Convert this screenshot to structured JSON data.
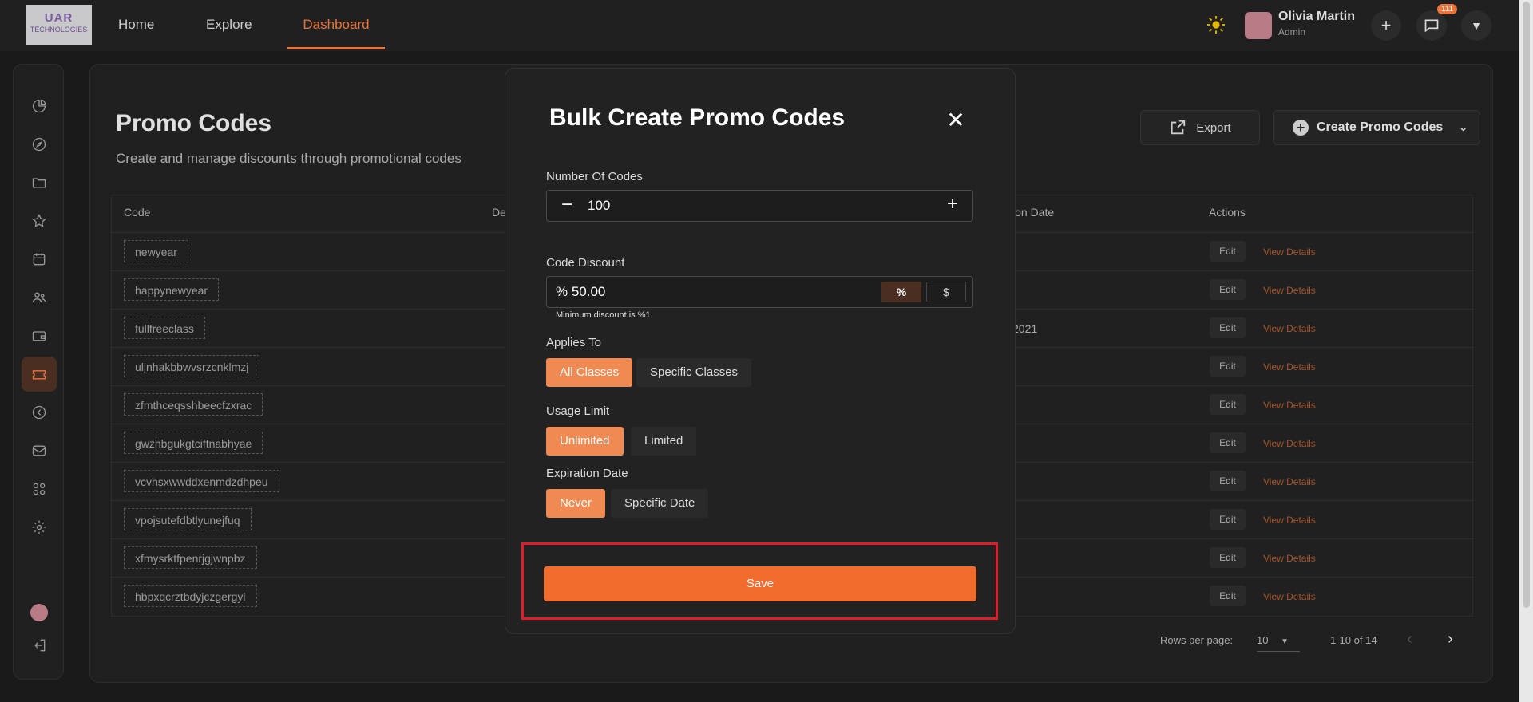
{
  "header": {
    "logo_line1": "UAR",
    "logo_line2": "TECHNOLOGIES",
    "nav": [
      {
        "label": "Home"
      },
      {
        "label": "Explore"
      },
      {
        "label": "Dashboard"
      }
    ],
    "user_name": "Olivia Martin",
    "user_role": "Admin",
    "notification_count": "111"
  },
  "page": {
    "title": "Promo Codes",
    "subtitle": "Create and manage discounts through promotional codes",
    "export_label": "Export",
    "create_label": "Create Promo Codes"
  },
  "table": {
    "headers": [
      "Code",
      "De",
      "ion Date",
      "Actions"
    ],
    "rows": [
      {
        "code": "newyear",
        "date": ""
      },
      {
        "code": "happynewyear",
        "date": ""
      },
      {
        "code": "fullfreeclass",
        "date": "2021"
      },
      {
        "code": "uljnhakbbwvsrzcnklmzj",
        "date": ""
      },
      {
        "code": "zfmthceqsshbeecfzxrac",
        "date": ""
      },
      {
        "code": "gwzhbgukgtciftnabhyae",
        "date": ""
      },
      {
        "code": "vcvhsxwwddxenmdzdhpeu",
        "date": ""
      },
      {
        "code": "vpojsutefdbtlyunejfuq",
        "date": ""
      },
      {
        "code": "xfmysrktfpenrjgjwnpbz",
        "date": ""
      },
      {
        "code": "hbpxqcrztbdyjczgergyi",
        "date": ""
      }
    ],
    "edit_label": "Edit",
    "view_label": "View Details",
    "rows_per_page_label": "Rows per page:",
    "rows_per_page": "10",
    "range": "1-10 of 14"
  },
  "modal": {
    "title": "Bulk Create Promo Codes",
    "num_codes_label": "Number Of Codes",
    "num_codes_value": "100",
    "discount_label": "Code Discount",
    "discount_value": "% 50.00",
    "percent_symbol": "%",
    "dollar_symbol": "$",
    "discount_hint": "Minimum discount is %1",
    "applies_label": "Applies To",
    "applies_options": [
      "All Classes",
      "Specific Classes"
    ],
    "usage_label": "Usage Limit",
    "usage_options": [
      "Unlimited",
      "Limited"
    ],
    "expiration_label": "Expiration Date",
    "expiration_options": [
      "Never",
      "Specific Date"
    ],
    "save_label": "Save"
  },
  "colors": {
    "accent": "#f06b2e",
    "highlight": "#e01e2a"
  }
}
